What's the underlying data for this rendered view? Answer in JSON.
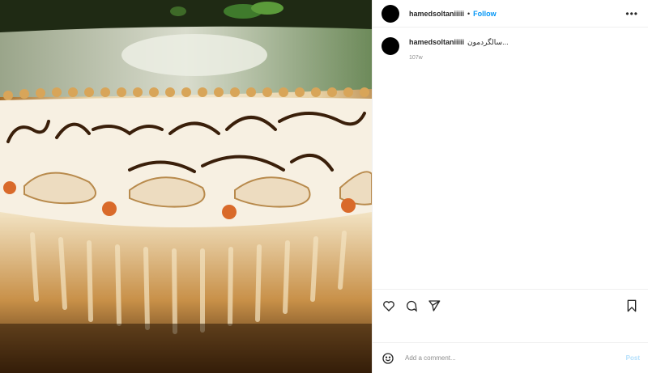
{
  "post": {
    "username": "hamedsoltaniiiii",
    "follow_label": "Follow",
    "separator": "•",
    "more_label": "•••",
    "caption_username": "hamedsoltaniiiii",
    "caption_text": "سالگردمون...",
    "time_ago": "107w",
    "comment_placeholder": "Add a comment...",
    "post_label": "Post",
    "image_alt": "cake with chocolate writing"
  },
  "colors": {
    "follow": "#0095f6",
    "post_disabled": "#b2dffc"
  }
}
